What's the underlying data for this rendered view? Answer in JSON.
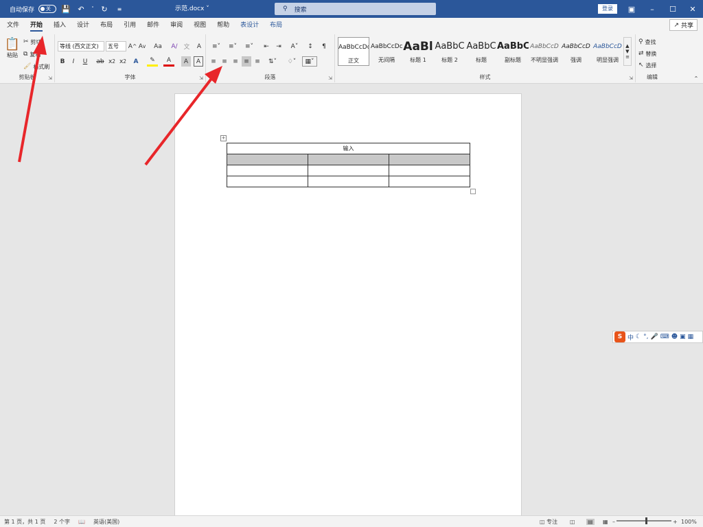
{
  "titlebar": {
    "autosave_label": "自动保存",
    "autosave_state": "关",
    "doc_title": "示范.docx",
    "search_placeholder": "搜索",
    "login_label": "登录"
  },
  "tabs": [
    "文件",
    "开始",
    "插入",
    "设计",
    "布局",
    "引用",
    "邮件",
    "审阅",
    "视图",
    "帮助",
    "表设计",
    "布局"
  ],
  "active_tab": "开始",
  "share_label": "共享",
  "clipboard": {
    "paste": "粘贴",
    "cut": "剪切",
    "copy": "复制",
    "painter": "格式刷",
    "group": "剪贴板"
  },
  "font": {
    "name": "等线 (西文正文)",
    "size": "五号",
    "group": "字体"
  },
  "paragraph": {
    "group": "段落"
  },
  "styles": {
    "group": "样式",
    "items": [
      {
        "preview": "AaBbCcDc",
        "name": "正文"
      },
      {
        "preview": "AaBbCcDc",
        "name": "无间隔"
      },
      {
        "preview": "AaBl",
        "name": "标题 1"
      },
      {
        "preview": "AaBbC",
        "name": "标题 2"
      },
      {
        "preview": "AaBbC",
        "name": "标题"
      },
      {
        "preview": "AaBbC",
        "name": "副标题"
      },
      {
        "preview": "AaBbCcD",
        "name": "不明显强调"
      },
      {
        "preview": "AaBbCcD",
        "name": "强调"
      },
      {
        "preview": "AaBbCcD",
        "name": "明显强调"
      }
    ]
  },
  "editing": {
    "find": "查找",
    "replace": "替换",
    "select": "选择",
    "group": "编辑"
  },
  "table": {
    "header": "输入",
    "rows": [
      [
        "",
        "",
        ""
      ],
      [
        "",
        "",
        ""
      ],
      [
        "",
        "",
        ""
      ]
    ]
  },
  "ime": {
    "mode": "中"
  },
  "statusbar": {
    "page": "第 1 页，共 1 页",
    "words": "2 个字",
    "language": "英语(美国)",
    "focus": "专注",
    "zoom": "100%"
  },
  "colors": {
    "brand": "#2b579a",
    "arrow": "#e8262a"
  }
}
